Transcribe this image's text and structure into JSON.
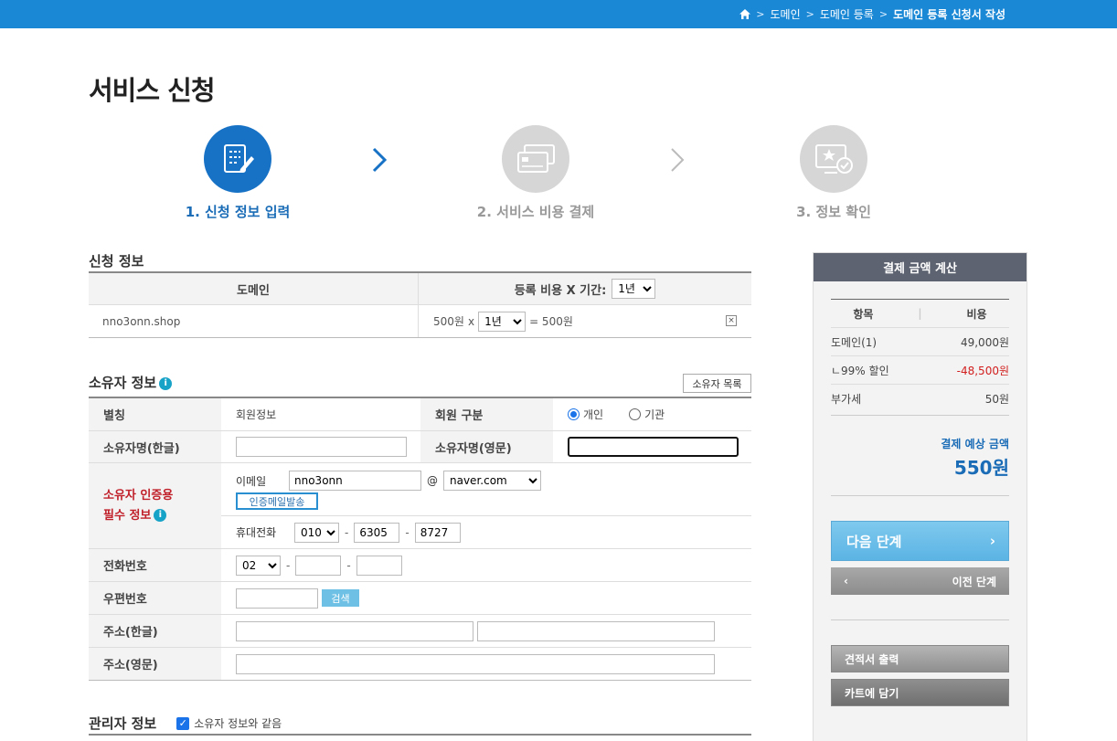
{
  "breadcrumb": {
    "items": [
      "도메인",
      "도메인 등록"
    ],
    "current": "도메인 등록 신청서 작성"
  },
  "page_title": "서비스 신청",
  "steps": [
    {
      "label": "1. 신청 정보 입력"
    },
    {
      "label": "2. 서비스 비용 결제"
    },
    {
      "label": "3. 정보 확인"
    }
  ],
  "application": {
    "section_title": "신청 정보",
    "col_domain": "도메인",
    "col_fee": "등록 비용 X 기간:",
    "period_select": "1년",
    "rows": [
      {
        "domain": "nno3onn.shop",
        "fee": "500원",
        "times": "x",
        "period": "1년",
        "total": "= 500원",
        "remove": "×"
      }
    ]
  },
  "owner": {
    "section_title": "소유자 정보",
    "list_button": "소유자 목록",
    "alias_label": "별칭",
    "alias_value": "회원정보",
    "member_type_label": "회원 구분",
    "member_type_options": [
      "개인",
      "기관"
    ],
    "member_type_selected": "개인",
    "name_kr_label": "소유자명(한글)",
    "name_kr_value": "",
    "name_en_label": "소유자명(영문)",
    "name_en_value": "",
    "auth_label_1": "소유자 인증용",
    "auth_label_2": "필수 정보",
    "email_label": "이메일",
    "email_id": "nno3onn",
    "email_at": "@",
    "email_domain": "naver.com",
    "send_auth_button": "인증메일발송",
    "mobile_label": "휴대전화",
    "mobile_prefix": "010",
    "mobile_mid": "6305",
    "mobile_last": "8727",
    "dash": "-",
    "phone_label": "전화번호",
    "phone_prefix": "02",
    "zip_label": "우편번호",
    "search_button": "검색",
    "addr_kr_label": "주소(한글)",
    "addr_en_label": "주소(영문)"
  },
  "admin": {
    "section_title": "관리자 정보",
    "same_as_owner": "소유자 정보와 같음",
    "checked": true
  },
  "calc": {
    "title": "결제 금액 계산",
    "col_item": "항목",
    "col_cost": "비용",
    "rows": [
      {
        "item": "도메인(1)",
        "cost": "49,000원"
      },
      {
        "item": "ㄴ99% 할인",
        "cost": "-48,500원",
        "discount": true
      },
      {
        "item": "부가세",
        "cost": "50원"
      }
    ],
    "estimate_label": "결제 예상 금액",
    "estimate_amount": "550원",
    "next_button": "다음 단계",
    "prev_button": "이전 단계",
    "quote_button": "견적서 출력",
    "cart_button": "카트에 담기"
  },
  "colors": {
    "accent": "#1b88d6",
    "step_active": "#1772c6",
    "step_inactive": "#d6d6d6",
    "required_red": "#c0202a",
    "discount_red": "#d21f1f"
  }
}
